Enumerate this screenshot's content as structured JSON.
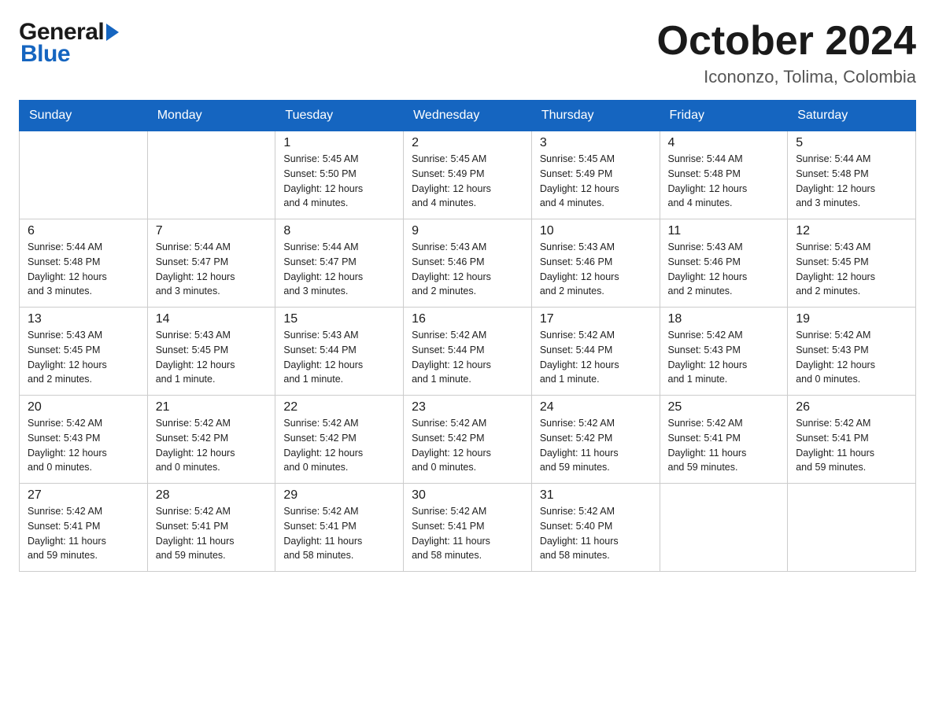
{
  "header": {
    "title": "October 2024",
    "location": "Icononzo, Tolima, Colombia"
  },
  "logo": {
    "general": "General",
    "blue": "Blue"
  },
  "days_of_week": [
    "Sunday",
    "Monday",
    "Tuesday",
    "Wednesday",
    "Thursday",
    "Friday",
    "Saturday"
  ],
  "weeks": [
    [
      {
        "day": "",
        "info": ""
      },
      {
        "day": "",
        "info": ""
      },
      {
        "day": "1",
        "info": "Sunrise: 5:45 AM\nSunset: 5:50 PM\nDaylight: 12 hours\nand 4 minutes."
      },
      {
        "day": "2",
        "info": "Sunrise: 5:45 AM\nSunset: 5:49 PM\nDaylight: 12 hours\nand 4 minutes."
      },
      {
        "day": "3",
        "info": "Sunrise: 5:45 AM\nSunset: 5:49 PM\nDaylight: 12 hours\nand 4 minutes."
      },
      {
        "day": "4",
        "info": "Sunrise: 5:44 AM\nSunset: 5:48 PM\nDaylight: 12 hours\nand 4 minutes."
      },
      {
        "day": "5",
        "info": "Sunrise: 5:44 AM\nSunset: 5:48 PM\nDaylight: 12 hours\nand 3 minutes."
      }
    ],
    [
      {
        "day": "6",
        "info": "Sunrise: 5:44 AM\nSunset: 5:48 PM\nDaylight: 12 hours\nand 3 minutes."
      },
      {
        "day": "7",
        "info": "Sunrise: 5:44 AM\nSunset: 5:47 PM\nDaylight: 12 hours\nand 3 minutes."
      },
      {
        "day": "8",
        "info": "Sunrise: 5:44 AM\nSunset: 5:47 PM\nDaylight: 12 hours\nand 3 minutes."
      },
      {
        "day": "9",
        "info": "Sunrise: 5:43 AM\nSunset: 5:46 PM\nDaylight: 12 hours\nand 2 minutes."
      },
      {
        "day": "10",
        "info": "Sunrise: 5:43 AM\nSunset: 5:46 PM\nDaylight: 12 hours\nand 2 minutes."
      },
      {
        "day": "11",
        "info": "Sunrise: 5:43 AM\nSunset: 5:46 PM\nDaylight: 12 hours\nand 2 minutes."
      },
      {
        "day": "12",
        "info": "Sunrise: 5:43 AM\nSunset: 5:45 PM\nDaylight: 12 hours\nand 2 minutes."
      }
    ],
    [
      {
        "day": "13",
        "info": "Sunrise: 5:43 AM\nSunset: 5:45 PM\nDaylight: 12 hours\nand 2 minutes."
      },
      {
        "day": "14",
        "info": "Sunrise: 5:43 AM\nSunset: 5:45 PM\nDaylight: 12 hours\nand 1 minute."
      },
      {
        "day": "15",
        "info": "Sunrise: 5:43 AM\nSunset: 5:44 PM\nDaylight: 12 hours\nand 1 minute."
      },
      {
        "day": "16",
        "info": "Sunrise: 5:42 AM\nSunset: 5:44 PM\nDaylight: 12 hours\nand 1 minute."
      },
      {
        "day": "17",
        "info": "Sunrise: 5:42 AM\nSunset: 5:44 PM\nDaylight: 12 hours\nand 1 minute."
      },
      {
        "day": "18",
        "info": "Sunrise: 5:42 AM\nSunset: 5:43 PM\nDaylight: 12 hours\nand 1 minute."
      },
      {
        "day": "19",
        "info": "Sunrise: 5:42 AM\nSunset: 5:43 PM\nDaylight: 12 hours\nand 0 minutes."
      }
    ],
    [
      {
        "day": "20",
        "info": "Sunrise: 5:42 AM\nSunset: 5:43 PM\nDaylight: 12 hours\nand 0 minutes."
      },
      {
        "day": "21",
        "info": "Sunrise: 5:42 AM\nSunset: 5:42 PM\nDaylight: 12 hours\nand 0 minutes."
      },
      {
        "day": "22",
        "info": "Sunrise: 5:42 AM\nSunset: 5:42 PM\nDaylight: 12 hours\nand 0 minutes."
      },
      {
        "day": "23",
        "info": "Sunrise: 5:42 AM\nSunset: 5:42 PM\nDaylight: 12 hours\nand 0 minutes."
      },
      {
        "day": "24",
        "info": "Sunrise: 5:42 AM\nSunset: 5:42 PM\nDaylight: 11 hours\nand 59 minutes."
      },
      {
        "day": "25",
        "info": "Sunrise: 5:42 AM\nSunset: 5:41 PM\nDaylight: 11 hours\nand 59 minutes."
      },
      {
        "day": "26",
        "info": "Sunrise: 5:42 AM\nSunset: 5:41 PM\nDaylight: 11 hours\nand 59 minutes."
      }
    ],
    [
      {
        "day": "27",
        "info": "Sunrise: 5:42 AM\nSunset: 5:41 PM\nDaylight: 11 hours\nand 59 minutes."
      },
      {
        "day": "28",
        "info": "Sunrise: 5:42 AM\nSunset: 5:41 PM\nDaylight: 11 hours\nand 59 minutes."
      },
      {
        "day": "29",
        "info": "Sunrise: 5:42 AM\nSunset: 5:41 PM\nDaylight: 11 hours\nand 58 minutes."
      },
      {
        "day": "30",
        "info": "Sunrise: 5:42 AM\nSunset: 5:41 PM\nDaylight: 11 hours\nand 58 minutes."
      },
      {
        "day": "31",
        "info": "Sunrise: 5:42 AM\nSunset: 5:40 PM\nDaylight: 11 hours\nand 58 minutes."
      },
      {
        "day": "",
        "info": ""
      },
      {
        "day": "",
        "info": ""
      }
    ]
  ]
}
